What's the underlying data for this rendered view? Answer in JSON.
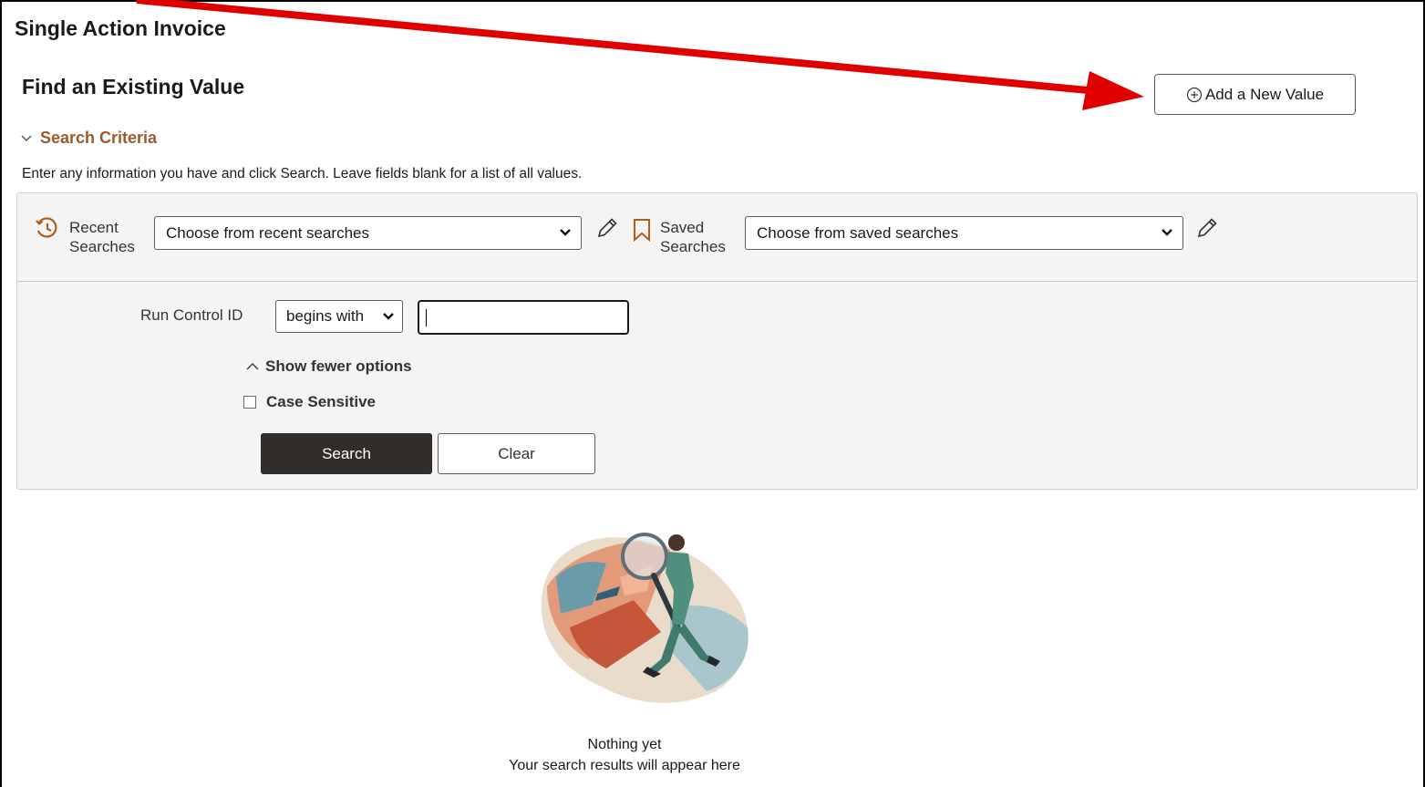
{
  "page": {
    "title": "Single Action Invoice",
    "section_title": "Find an Existing Value",
    "add_button_label": "Add a New Value"
  },
  "search_criteria": {
    "toggle_label": "Search Criteria",
    "instructions": "Enter any information you have and click Search. Leave fields blank for a list of all values.",
    "recent": {
      "label_line1": "Recent",
      "label_line2": "Searches",
      "select_value": "Choose from recent searches"
    },
    "saved": {
      "label_line1": "Saved",
      "label_line2": "Searches",
      "select_value": "Choose from saved searches"
    },
    "run_control": {
      "label": "Run Control ID",
      "operator": "begins with",
      "value": ""
    },
    "show_fewer_label": "Show fewer options",
    "case_sensitive_label": "Case Sensitive",
    "case_sensitive_checked": false,
    "search_button_label": "Search",
    "clear_button_label": "Clear"
  },
  "empty_state": {
    "title": "Nothing yet",
    "subtitle": "Your search results will appear here"
  },
  "colors": {
    "accent_link": "#9a5a2c",
    "primary_button": "#312d2a",
    "annotation_arrow": "#e00000"
  },
  "icons": [
    "add-circle-icon",
    "chevron-down-icon",
    "history-icon",
    "pencil-icon",
    "bookmark-icon",
    "chevron-up-icon",
    "search-illustration"
  ]
}
